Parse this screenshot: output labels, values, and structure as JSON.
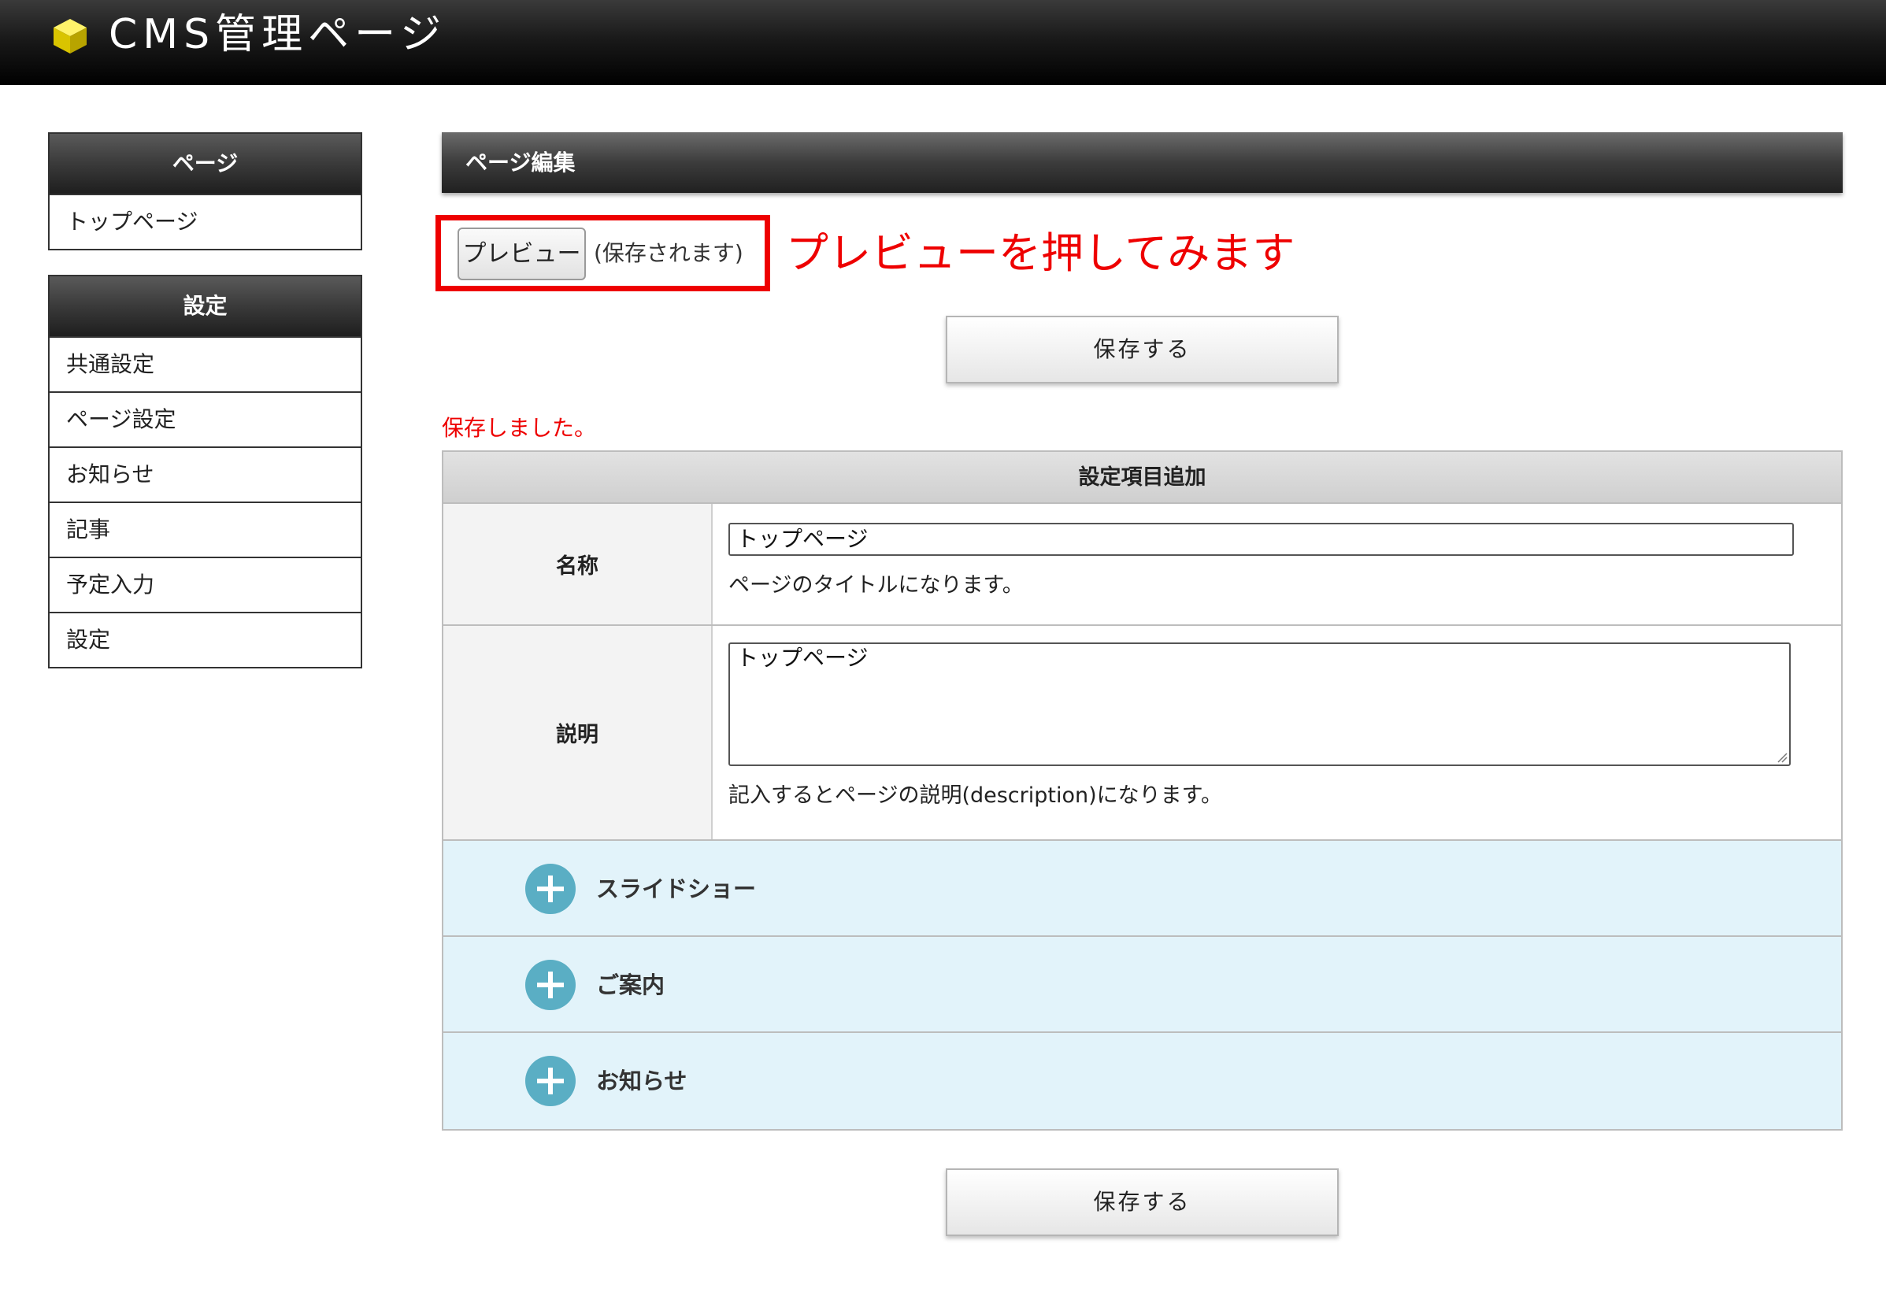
{
  "header": {
    "app_title": "CMS管理ページ",
    "logo_icon": "yellow-cube-icon"
  },
  "sidebar": {
    "page_section": {
      "title": "ページ",
      "items": [
        "トップページ"
      ]
    },
    "settings_section": {
      "title": "設定",
      "items": [
        "共通設定",
        "ページ設定",
        "お知らせ",
        "記事",
        "予定入力",
        "設定"
      ]
    }
  },
  "main": {
    "section_title": "ページ編集",
    "preview_button": "プレビュー",
    "preview_note": "(保存されます)",
    "annotation": "プレビューを押してみます",
    "save_button": "保存する",
    "saved_message": "保存しました。",
    "table": {
      "header": "設定項目追加",
      "name_label": "名称",
      "name_value": "トップページ",
      "name_hint": "ページのタイトルになります。",
      "desc_label": "説明",
      "desc_value": "トップページ",
      "desc_hint": "記入するとページの説明(description)になります。",
      "add_items": [
        "スライドショー",
        "ご案内",
        "お知らせ"
      ]
    }
  },
  "colors": {
    "annotation_red": "#ee0000",
    "add_row_bg": "#e2f3fa",
    "plus_circle": "#5aaec4"
  }
}
